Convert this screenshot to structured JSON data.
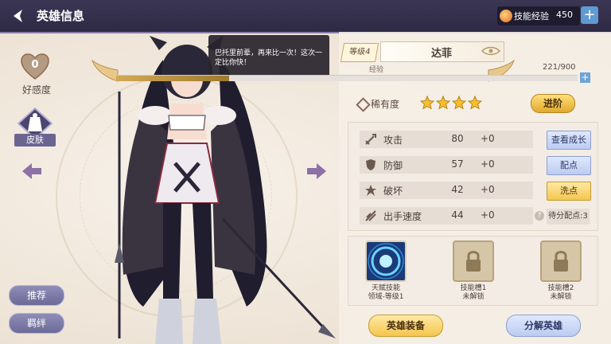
{
  "header": {
    "title": "英雄信息",
    "skill_exp_label": "技能经验",
    "skill_exp_value": "450"
  },
  "left": {
    "favor_value": "0",
    "favor_label": "好感度",
    "skin_label": "皮肤",
    "recommend_label": "推荐",
    "bond_label": "羁绊"
  },
  "tooltip": {
    "text": "巴托里前辈，再来比一次！这次一定比你快！"
  },
  "hero": {
    "level": "等级4",
    "name": "达菲",
    "exp_label": "经验",
    "exp_value": "221/900",
    "exp_progress": 0.245,
    "rarity_label": "稀有度",
    "stars": 4,
    "advance_label": "进阶"
  },
  "stats": [
    {
      "name": "攻击",
      "value": "80",
      "bonus": "+0",
      "icon": "sword-icon"
    },
    {
      "name": "防御",
      "value": "57",
      "bonus": "+0",
      "icon": "shield-icon"
    },
    {
      "name": "破坏",
      "value": "42",
      "bonus": "+0",
      "icon": "burst-icon"
    },
    {
      "name": "出手速度",
      "value": "44",
      "bonus": "+0",
      "icon": "speed-icon"
    }
  ],
  "stat_buttons": {
    "growth": "查看成长",
    "allocate": "配点",
    "reset": "洗点",
    "pending_points": "待分配点:3"
  },
  "skills": [
    {
      "line1": "天赋技能",
      "line2": "领域-等级1",
      "locked": false
    },
    {
      "line1": "技能槽1",
      "line2": "未解锁",
      "locked": true
    },
    {
      "line1": "技能槽2",
      "line2": "未解锁",
      "locked": true
    }
  ],
  "bottom": {
    "equip_label": "英雄装备",
    "decompose_label": "分解英雄"
  },
  "colors": {
    "topbar": "#2e2a45",
    "accent_gold": "#e0a82c",
    "accent_blue": "#6ea3d8"
  }
}
